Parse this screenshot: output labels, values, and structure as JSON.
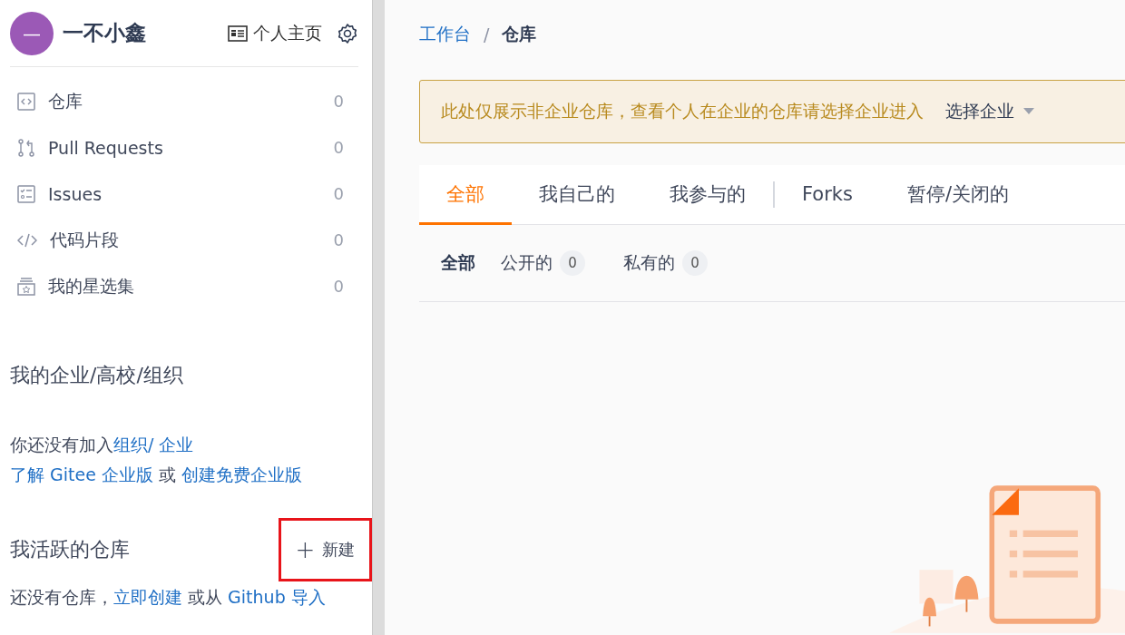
{
  "sidebar": {
    "user": {
      "avatar_text": "—",
      "name": "一不小鑫",
      "home_link": "个人主页"
    },
    "nav_items": [
      {
        "kind": "repo",
        "label": "仓库",
        "count": "0"
      },
      {
        "kind": "pull",
        "label": "Pull Requests",
        "count": "0"
      },
      {
        "kind": "issue",
        "label": "Issues",
        "count": "0"
      },
      {
        "kind": "code",
        "label": "代码片段",
        "count": "0"
      },
      {
        "kind": "star",
        "label": "我的星选集",
        "count": "0"
      }
    ],
    "org_section": {
      "heading": "我的企业/高校/组织",
      "lines": [
        [
          {
            "text": "你还没有加入",
            "kind": "text"
          },
          {
            "text": "组织/ 企业",
            "kind": "link"
          }
        ],
        [
          {
            "text": "了解 Gitee 企业版",
            "kind": "link"
          },
          {
            "text": " 或 ",
            "kind": "text"
          },
          {
            "text": "创建免费企业版",
            "kind": "link"
          }
        ]
      ]
    },
    "active_repos": {
      "heading": "我活跃的仓库",
      "new_button": {
        "icon": "+",
        "label": "新建",
        "highlighted": true
      },
      "line": [
        {
          "text": "还没有仓库，",
          "kind": "text"
        },
        {
          "text": "立即创建",
          "kind": "link"
        },
        {
          "text": " 或从 ",
          "kind": "text"
        },
        {
          "text": "Github 导入",
          "kind": "link"
        }
      ]
    }
  },
  "main": {
    "breadcrumb": [
      {
        "label": "工作台",
        "current": false
      },
      {
        "label": "仓库",
        "current": true
      }
    ],
    "breadcrumb_separator": "/",
    "notice": {
      "text": "此处仅展示非企业仓库，查看个人在企业的仓库请选择企业进入",
      "select": "选择企业"
    },
    "tabs": [
      {
        "label": "全部",
        "selected": true,
        "divider_after": false
      },
      {
        "label": "我自己的",
        "selected": false,
        "divider_after": false
      },
      {
        "label": "我参与的",
        "selected": false,
        "divider_after": true
      },
      {
        "label": "Forks",
        "selected": false,
        "divider_after": false
      },
      {
        "label": "暂停/关闭的",
        "selected": false,
        "divider_after": false
      }
    ],
    "filters": [
      {
        "label": "全部",
        "selected": true
      },
      {
        "label": "公开的",
        "count": "0",
        "selected": false
      },
      {
        "label": "私有的",
        "count": "0",
        "selected": false
      }
    ]
  }
}
